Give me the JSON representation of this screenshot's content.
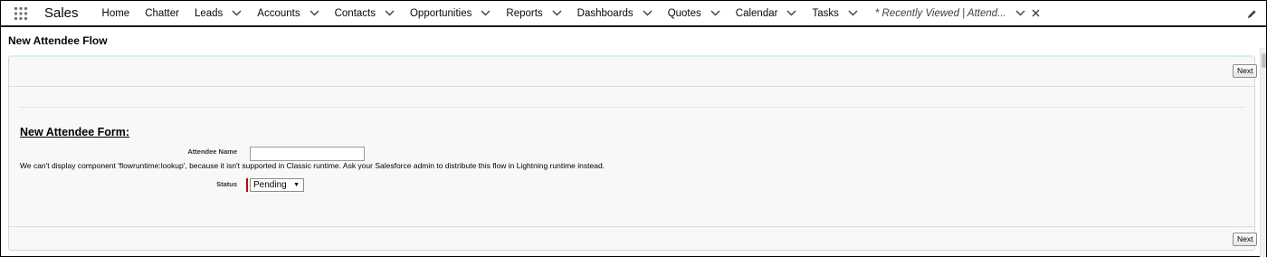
{
  "nav": {
    "app_name": "Sales",
    "items": [
      {
        "label": "Home",
        "has_menu": false
      },
      {
        "label": "Chatter",
        "has_menu": false
      },
      {
        "label": "Leads",
        "has_menu": true
      },
      {
        "label": "Accounts",
        "has_menu": true
      },
      {
        "label": "Contacts",
        "has_menu": true
      },
      {
        "label": "Opportunities",
        "has_menu": true
      },
      {
        "label": "Reports",
        "has_menu": true
      },
      {
        "label": "Dashboards",
        "has_menu": true
      },
      {
        "label": "Quotes",
        "has_menu": true
      },
      {
        "label": "Calendar",
        "has_menu": true
      },
      {
        "label": "Tasks",
        "has_menu": true
      }
    ],
    "active_tab": {
      "label": "* Recently Viewed | Attend..."
    }
  },
  "page": {
    "title": "New Attendee Flow"
  },
  "flow": {
    "next_top": "Next",
    "next_bottom": "Next",
    "form_title": "New Attendee Form:",
    "attendee_name_label": "Attendee Name",
    "attendee_name_value": "",
    "error_message": "We can't display component 'flowruntime:lookup', because it isn't supported in Classic runtime. Ask your Salesforce admin to distribute this flow in Lightning runtime instead.",
    "status_label": "Status",
    "status_value": "Pending"
  },
  "colors": {
    "required_marker": "#cc0000",
    "panel_top_border": "#d8eef5"
  }
}
